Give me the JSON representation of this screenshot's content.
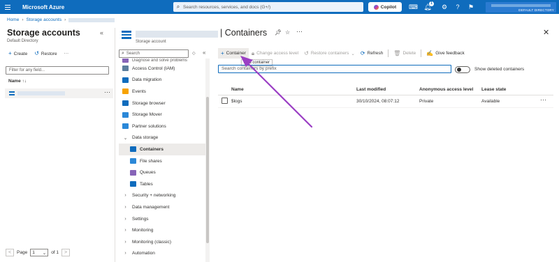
{
  "topbar": {
    "brand": "Microsoft Azure",
    "search_placeholder": "Search resources, services, and docs (G+/)",
    "copilot_label": "Copilot",
    "notification_count": "1",
    "account_directory": "DEFAULT DIRECTORY",
    "icons": [
      "menu-icon",
      "search-icon",
      "cloud-shell-icon",
      "bell-icon",
      "settings-icon",
      "help-icon",
      "feedback-icon"
    ]
  },
  "breadcrumb": {
    "home": "Home",
    "storage_accounts": "Storage accounts"
  },
  "left_panel": {
    "title": "Storage accounts",
    "subtitle": "Default Directory",
    "collapse_glyph": "«",
    "create_label": "Create",
    "restore_label": "Restore",
    "more_glyph": "···",
    "filter_placeholder": "Filter for any field...",
    "name_header": "Name ↑↓",
    "pager": {
      "page_label": "Page",
      "page_value": "1",
      "of_label": "of 1",
      "prev": "<",
      "next": ">"
    }
  },
  "resource": {
    "title": "| Containers",
    "subtitle": "Storage account"
  },
  "menu": {
    "search_placeholder": "Search",
    "option_glyph": "◇",
    "collapse_glyph": "«",
    "items": [
      {
        "label": "Diagnose and solve problems",
        "type": "cut",
        "color": "#8764b8"
      },
      {
        "label": "Access Control (IAM)",
        "type": "item",
        "color": "#5c7e9e"
      },
      {
        "label": "Data migration",
        "type": "item",
        "color": "#0f6cbd"
      },
      {
        "label": "Events",
        "type": "item",
        "color": "#f7a200"
      },
      {
        "label": "Storage browser",
        "type": "item",
        "color": "#0f6cbd"
      },
      {
        "label": "Storage Mover",
        "type": "item",
        "color": "#2b88d8"
      },
      {
        "label": "Partner solutions",
        "type": "item",
        "color": "#2b88d8"
      },
      {
        "label": "Data storage",
        "type": "group-open"
      },
      {
        "label": "Containers",
        "type": "sub-active",
        "color": "#0f6cbd"
      },
      {
        "label": "File shares",
        "type": "sub",
        "color": "#2b88d8"
      },
      {
        "label": "Queues",
        "type": "sub",
        "color": "#8764b8"
      },
      {
        "label": "Tables",
        "type": "sub",
        "color": "#0f6cbd"
      },
      {
        "label": "Security + networking",
        "type": "group"
      },
      {
        "label": "Data management",
        "type": "group"
      },
      {
        "label": "Settings",
        "type": "group"
      },
      {
        "label": "Monitoring",
        "type": "group"
      },
      {
        "label": "Monitoring (classic)",
        "type": "group"
      },
      {
        "label": "Automation",
        "type": "group"
      }
    ]
  },
  "toolbar": {
    "container": "Container",
    "change_access": "Change access level",
    "restore_containers": "Restore containers",
    "refresh": "Refresh",
    "delete": "Delete",
    "feedback": "Give feedback",
    "tooltip": "Add container"
  },
  "main": {
    "search_placeholder": "Search containers by prefix",
    "show_deleted": "Show deleted containers",
    "columns": [
      "Name",
      "Last modified",
      "Anonymous access level",
      "Lease state"
    ],
    "rows": [
      {
        "name": "$logs",
        "last_modified": "30/10/2024, 08:07:12",
        "access": "Private",
        "lease": "Available"
      }
    ],
    "row_more": "···"
  },
  "accent_color": "#0f6cbd",
  "annotation_arrow_color": "#9b3fc4"
}
